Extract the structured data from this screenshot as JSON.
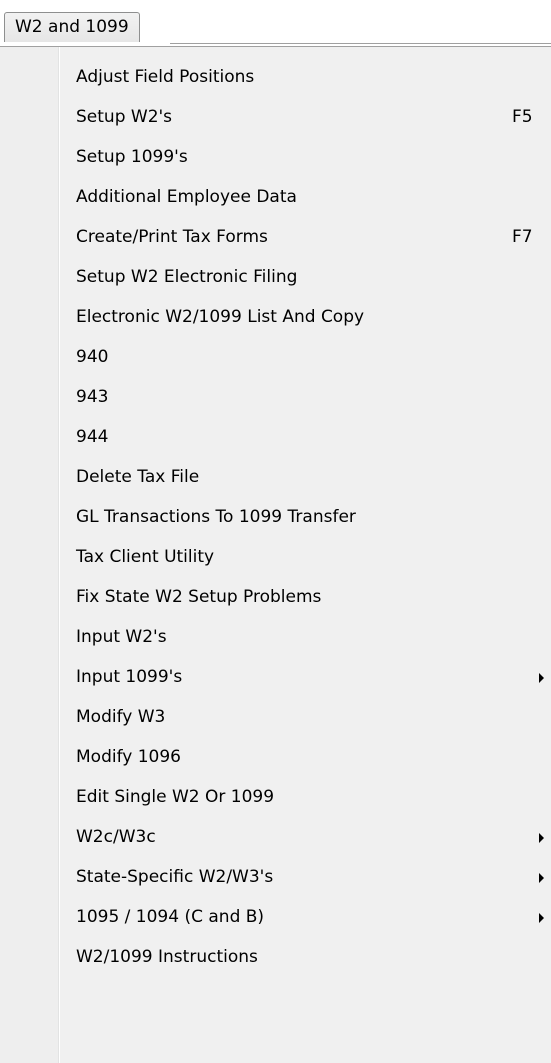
{
  "menu": {
    "title": "W2 and 1099",
    "items": [
      {
        "label": "Adjust Field Positions",
        "shortcut": "",
        "submenu": false
      },
      {
        "label": "Setup W2's",
        "shortcut": "F5",
        "submenu": false
      },
      {
        "label": "Setup 1099's",
        "shortcut": "",
        "submenu": false
      },
      {
        "label": "Additional Employee Data",
        "shortcut": "",
        "submenu": false
      },
      {
        "label": "Create/Print Tax Forms",
        "shortcut": "F7",
        "submenu": false
      },
      {
        "label": "Setup W2 Electronic Filing",
        "shortcut": "",
        "submenu": false
      },
      {
        "label": "Electronic W2/1099 List And Copy",
        "shortcut": "",
        "submenu": false
      },
      {
        "label": "940",
        "shortcut": "",
        "submenu": false
      },
      {
        "label": "943",
        "shortcut": "",
        "submenu": false
      },
      {
        "label": "944",
        "shortcut": "",
        "submenu": false
      },
      {
        "label": "Delete Tax File",
        "shortcut": "",
        "submenu": false
      },
      {
        "label": "GL Transactions To 1099 Transfer",
        "shortcut": "",
        "submenu": false
      },
      {
        "label": "Tax Client Utility",
        "shortcut": "",
        "submenu": false
      },
      {
        "label": "Fix State W2 Setup Problems",
        "shortcut": "",
        "submenu": false
      },
      {
        "label": "Input W2's",
        "shortcut": "",
        "submenu": false
      },
      {
        "label": "Input 1099's",
        "shortcut": "",
        "submenu": true
      },
      {
        "label": "Modify W3",
        "shortcut": "",
        "submenu": false
      },
      {
        "label": "Modify 1096",
        "shortcut": "",
        "submenu": false
      },
      {
        "label": "Edit Single W2 Or 1099",
        "shortcut": "",
        "submenu": false
      },
      {
        "label": "W2c/W3c",
        "shortcut": "",
        "submenu": true
      },
      {
        "label": "State-Specific W2/W3's",
        "shortcut": "",
        "submenu": true
      },
      {
        "label": "1095 / 1094 (C and B)",
        "shortcut": "",
        "submenu": true
      },
      {
        "label": "W2/1099 Instructions",
        "shortcut": "",
        "submenu": false
      }
    ]
  }
}
